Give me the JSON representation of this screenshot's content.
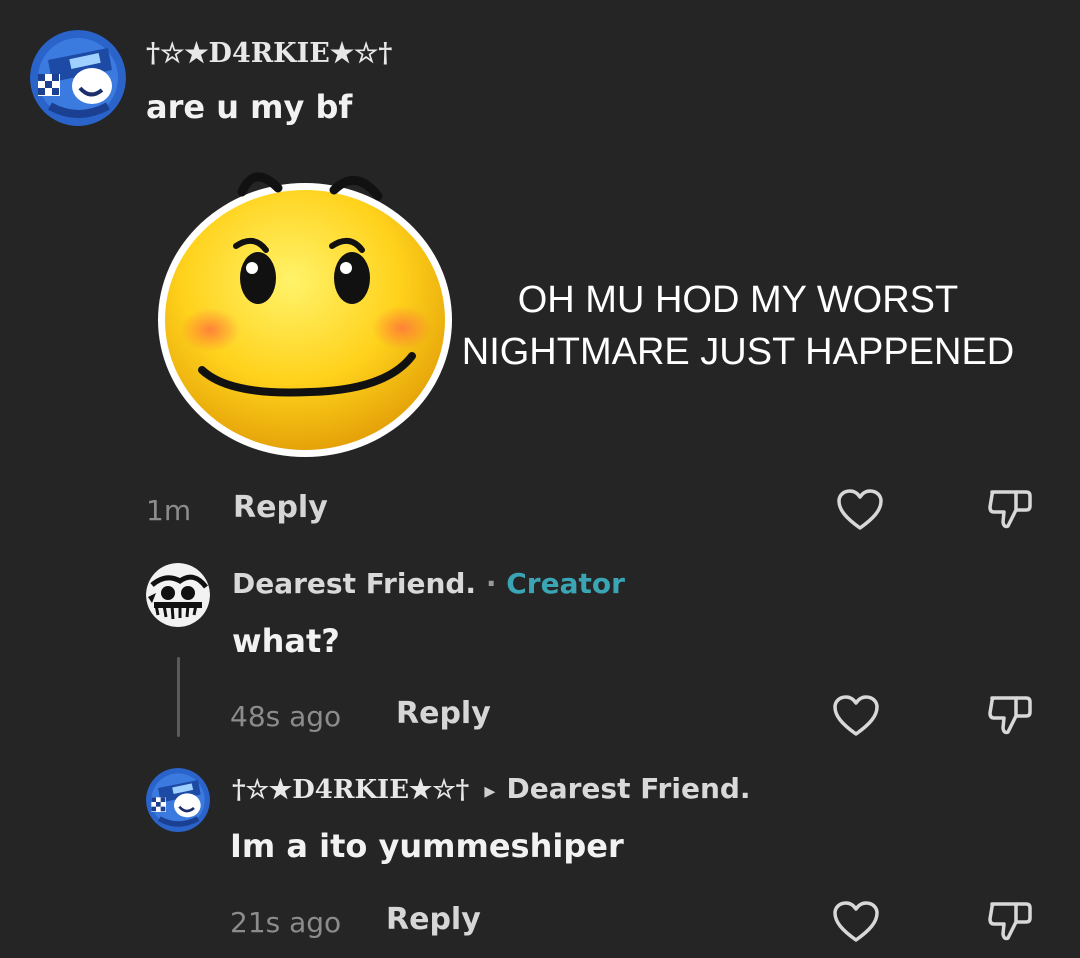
{
  "comments": [
    {
      "username": "†☆★D4RKIE★☆†",
      "text": "are u my bf",
      "time": "1m",
      "reply_label": "Reply",
      "sticker_caption": "OH MU HOD MY WORST NIGHTMARE JUST HAPPENED"
    },
    {
      "username": "Dearest Friend.",
      "separator": "·",
      "badge": "Creator",
      "text": "what?",
      "time": "48s ago",
      "reply_label": "Reply"
    },
    {
      "username": "†☆★D4RKIE★☆†",
      "reply_arrow": "▸",
      "reply_to": "Dearest Friend.",
      "text": "Im a ito yummeshiper",
      "time": "21s ago",
      "reply_label": "Reply"
    }
  ],
  "colors": {
    "background": "#252525",
    "creator_badge": "#3aa6b5",
    "muted_text": "#8c8c8c"
  },
  "icons": [
    "heart-outline-icon",
    "thumbs-down-outline-icon"
  ]
}
